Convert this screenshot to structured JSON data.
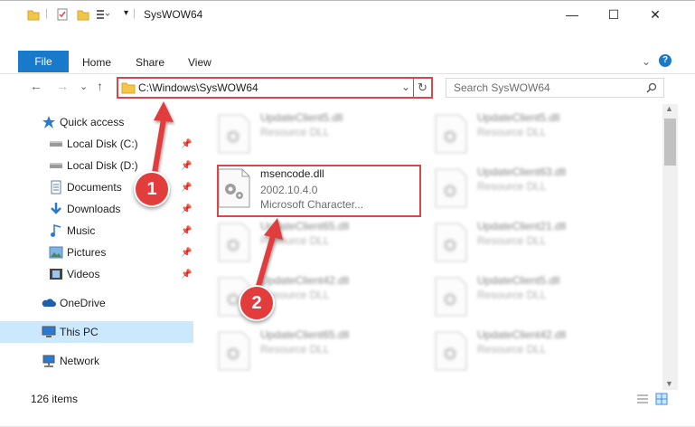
{
  "window": {
    "title": "SysWOW64",
    "controls": {
      "minimize": "—",
      "maximize": "☐",
      "close": "✕"
    }
  },
  "ribbon": {
    "tabs": [
      "File",
      "Home",
      "Share",
      "View"
    ],
    "help": "?",
    "collapse": "⌄"
  },
  "navigation": {
    "back": "←",
    "forward": "→",
    "recent": "⌄",
    "up": "↑",
    "address": "C:\\Windows\\SysWOW64",
    "address_dropdown": "⌄",
    "refresh": "↻",
    "search_placeholder": "Search SysWOW64"
  },
  "sidebar": {
    "items": [
      {
        "label": "Quick access",
        "icon": "star-icon"
      },
      {
        "label": "Local Disk (C:)",
        "icon": "drive-icon",
        "pinned": true
      },
      {
        "label": "Local Disk (D:)",
        "icon": "drive-icon",
        "pinned": true
      },
      {
        "label": "Documents",
        "icon": "documents-icon",
        "pinned": true
      },
      {
        "label": "Downloads",
        "icon": "download-icon",
        "pinned": true
      },
      {
        "label": "Music",
        "icon": "music-icon",
        "pinned": true
      },
      {
        "label": "Pictures",
        "icon": "pictures-icon",
        "pinned": true
      },
      {
        "label": "Videos",
        "icon": "videos-icon",
        "pinned": true
      },
      {
        "label": "OneDrive",
        "icon": "cloud-icon"
      },
      {
        "label": "This PC",
        "icon": "pc-icon",
        "selected": true
      },
      {
        "label": "Network",
        "icon": "network-icon"
      }
    ]
  },
  "files": [
    {
      "name": "UpdateClient5.dll",
      "type": "Resource DLL",
      "blurred": true
    },
    {
      "name": "UpdateClient5.dll",
      "type": "Resource DLL",
      "blurred": true
    },
    {
      "name": "msencode.dll",
      "version": "2002.10.4.0",
      "company": "Microsoft Character...",
      "blurred": false
    },
    {
      "name": "UpdateClient63.dll",
      "type": "Resource DLL",
      "blurred": true
    },
    {
      "name": "UpdateClient65.dll",
      "type": "Resource DLL",
      "blurred": true
    },
    {
      "name": "UpdateClient21.dll",
      "type": "Resource DLL",
      "blurred": true
    },
    {
      "name": "UpdateClient42.dll",
      "type": "Resource DLL",
      "blurred": true
    },
    {
      "name": "UpdateClient5.dll",
      "type": "Resource DLL",
      "blurred": true
    },
    {
      "name": "UpdateClient65.dll",
      "type": "Resource DLL",
      "blurred": true
    },
    {
      "name": "UpdateClient42.dll",
      "type": "Resource DLL",
      "blurred": true
    }
  ],
  "status": {
    "item_count": "126 items"
  },
  "callouts": [
    "1",
    "2"
  ],
  "colors": {
    "accent": "#1979ca",
    "highlight": "#d64949",
    "selection": "#cce8ff"
  }
}
